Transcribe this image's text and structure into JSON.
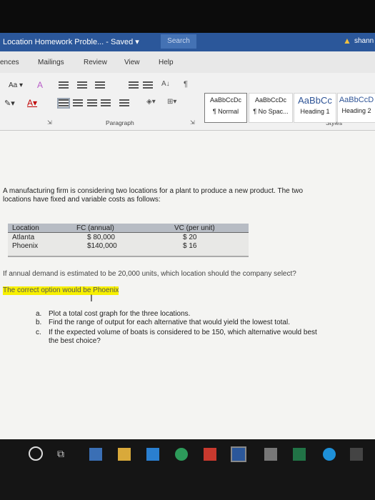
{
  "window": {
    "doc_title": "Location Homework Proble... - Saved ▾",
    "search_label": "Search",
    "user_name": "shann"
  },
  "ribbon_tabs": [
    "ences",
    "Mailings",
    "Review",
    "View",
    "Help"
  ],
  "ribbon": {
    "font_size_btn": "Aa ▾",
    "clear_format": "A",
    "paragraph_label": "Paragraph",
    "styles_label": "Styles",
    "styles": [
      {
        "sample": "AaBbCcDc",
        "name": "¶ Normal"
      },
      {
        "sample": "AaBbCcDc",
        "name": "¶ No Spac..."
      },
      {
        "sample": "AaBbCc",
        "name": "Heading 1"
      },
      {
        "sample": "AaBbCcD",
        "name": "Heading 2"
      }
    ]
  },
  "document": {
    "intro_line1": "A manufacturing firm is considering two locations for a plant to produce a new product. The two",
    "intro_line2": "locations have fixed and variable costs as follows:",
    "table": {
      "headers": [
        "Location",
        "FC (annual)",
        "VC (per unit)"
      ],
      "rows": [
        [
          "Atlanta",
          "$ 80,000",
          "$ 20"
        ],
        [
          "Phoenix",
          "$140,000",
          "$ 16"
        ]
      ]
    },
    "question": "If annual demand is estimated to be 20,000 units, which location should the company select?",
    "answer": "The correct option would be Phoenix",
    "items": [
      {
        "marker": "a.",
        "line1": "Plot a total cost graph for the three locations.",
        "line2": ""
      },
      {
        "marker": "b.",
        "line1": "Find the range of output for each alternative that would yield the lowest total.",
        "line2": ""
      },
      {
        "marker": "c.",
        "line1": "If the expected volume of boats is considered to be 150, which alternative would best",
        "line2": "the best choice?"
      }
    ]
  },
  "colors": {
    "title_bar": "#2b579a",
    "highlight": "#f7f000",
    "taskbar": "#151515"
  }
}
